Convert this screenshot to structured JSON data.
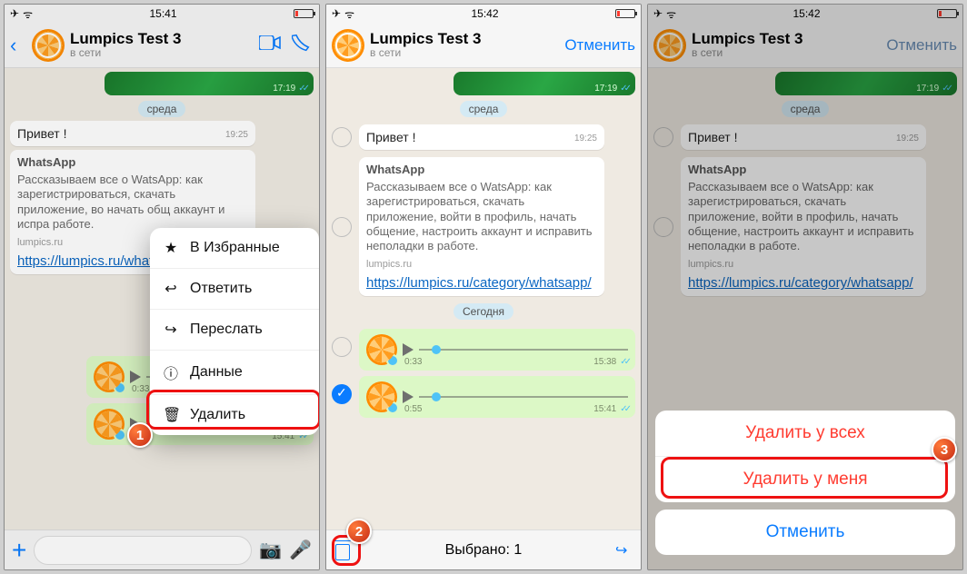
{
  "status": {
    "time1": "15:41",
    "time2": "15:42",
    "time3": "15:42"
  },
  "chat": {
    "name": "Lumpics Test 3",
    "presence": "в сети",
    "cancel": "Отменить"
  },
  "dates": {
    "wed": "среда",
    "today": "Сегодня"
  },
  "greeting": {
    "text": "Привет !",
    "ts": "19:25"
  },
  "preview": {
    "title": "WhatsApp",
    "desc_full": "Рассказываем все о WatsApp: как зарегистрироваться, скачать приложение, войти в профиль, начать общение, настроить аккаунт и исправить неполадки в работе.",
    "desc_trunc": "Рассказываем все о WatsApp: как зарегистрироваться, скачать приложение, во начать общ аккаунт и испра работе.",
    "domain": "lumpics.ru"
  },
  "link": {
    "short": "https://lumpics.ru/whatsapp/",
    "long": "https://lumpics.ru/category/whatsapp/"
  },
  "imgmsg": {
    "ts": "17:19"
  },
  "audio1": {
    "dur": "0:33",
    "ts": "15:38"
  },
  "audio2": {
    "dur": "0:55",
    "ts": "15:41"
  },
  "menu": {
    "fav": "В Избранные",
    "reply": "Ответить",
    "forward": "Переслать",
    "info": "Данные",
    "delete": "Удалить"
  },
  "footer": {
    "selected": "Выбрано: 1"
  },
  "sheet": {
    "all": "Удалить у всех",
    "me": "Удалить у меня",
    "cancel": "Отменить"
  },
  "badge": {
    "one": "1",
    "two": "2",
    "three": "3"
  }
}
